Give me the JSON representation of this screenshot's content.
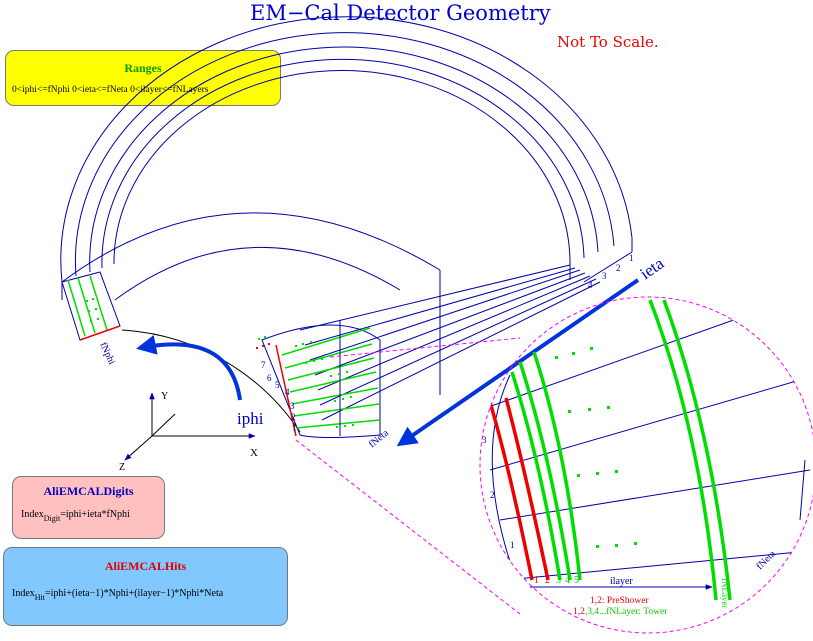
{
  "title": "EM−Cal Detector Geometry",
  "scale_note": "Not To Scale.",
  "ranges": {
    "title": "Ranges",
    "text": "0<iphi<=fNphi    0<ieta<=fNeta    0<ilayer<=fNLayers"
  },
  "digits_box": {
    "title": "AliEMCALDigits",
    "index_word": "Index",
    "index_sub": "Digit",
    "formula": "=iphi+ieta*fNphi"
  },
  "hits_box": {
    "title": "AliEMCALHits",
    "index_word": "Index",
    "index_sub": "Hit",
    "formula": "=iphi+(ieta−1)*Nphi+(ilayer−1)*Nphi*Neta"
  },
  "axes": {
    "x": "X",
    "y": "Y",
    "z": "Z"
  },
  "labels": {
    "iphi": "iphi",
    "ieta": "ieta",
    "fnphi": "fNphi",
    "fneta": "fNeta",
    "fneta_zoom": "fNeta",
    "ilayer": "ilayer",
    "fnlayer_vertical": "fNLayer"
  },
  "eta_numbers": [
    "1",
    "2",
    "3",
    "4"
  ],
  "left_layer_numbers": [
    "7",
    "6",
    "5",
    "4",
    "3",
    "2",
    "1"
  ],
  "zoom_phi_numbers": [
    "1",
    "2",
    "3"
  ],
  "zoom_layer_numbers": [
    "1",
    "2",
    "3",
    "4",
    "5"
  ],
  "legend": {
    "preshower": "1,2: PreShower",
    "tower_prefix_red": "1,2",
    "tower_rest": ",3,4...fNLayer: Tower"
  },
  "colors": {
    "title": "#0000cc",
    "geometry": "#0000aa",
    "layer_green": "#00dd00",
    "preshower_red": "#ee0000",
    "arrow_blue": "#0033dd",
    "zoom_outline": "#ff00ff"
  }
}
